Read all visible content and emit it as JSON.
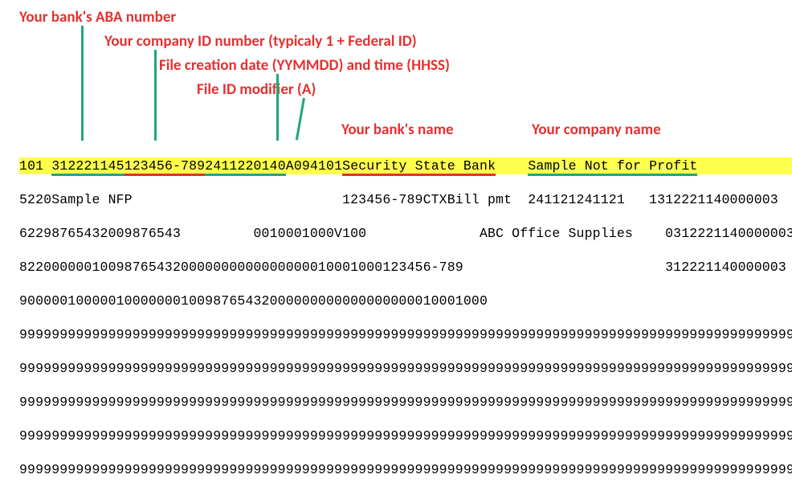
{
  "annotations": {
    "aba": "Your bank's ABA number",
    "company_id": "Your company ID number (typicaly 1 + Federal ID)",
    "creation": "File creation date (YYMMDD) and time (HHSS)",
    "modifier": "File ID modifier (A)",
    "bank_name": "Your bank's name",
    "company_name": "Your company name"
  },
  "record1": {
    "record_type": "1",
    "priority": "01",
    "sp": " ",
    "aba": "312221145",
    "company_id": "123456-789",
    "date_time": "2411220140",
    "modifier": "A",
    "block_fmt": "094101",
    "bank_name": "Security State Bank",
    "pad1": "    ",
    "company_name": "Sample Not for Profit"
  },
  "rows": {
    "r2": "5220Sample NFP                          123456-789CTXBill pmt  241121241121   1312221140000003",
    "r3": "62298765432009876543         0010001000V100              ABC Office Supplies    0312221140000003",
    "r4": "822000000100987654320000000000000000010001000123456-789                         312221140000003",
    "r5": "9000001000001000000010098765432000000000000000000010001000",
    "r6": "9999999999999999999999999999999999999999999999999999999999999999999999999999999999999999999999999",
    "r7": "9999999999999999999999999999999999999999999999999999999999999999999999999999999999999999999999999",
    "r8": "9999999999999999999999999999999999999999999999999999999999999999999999999999999999999999999999999",
    "r9": "9999999999999999999999999999999999999999999999999999999999999999999999999999999999999999999999999",
    "r10": "9999999999999999999999999999999999999999999999999999999999999999999999999999999999999999999999999"
  }
}
